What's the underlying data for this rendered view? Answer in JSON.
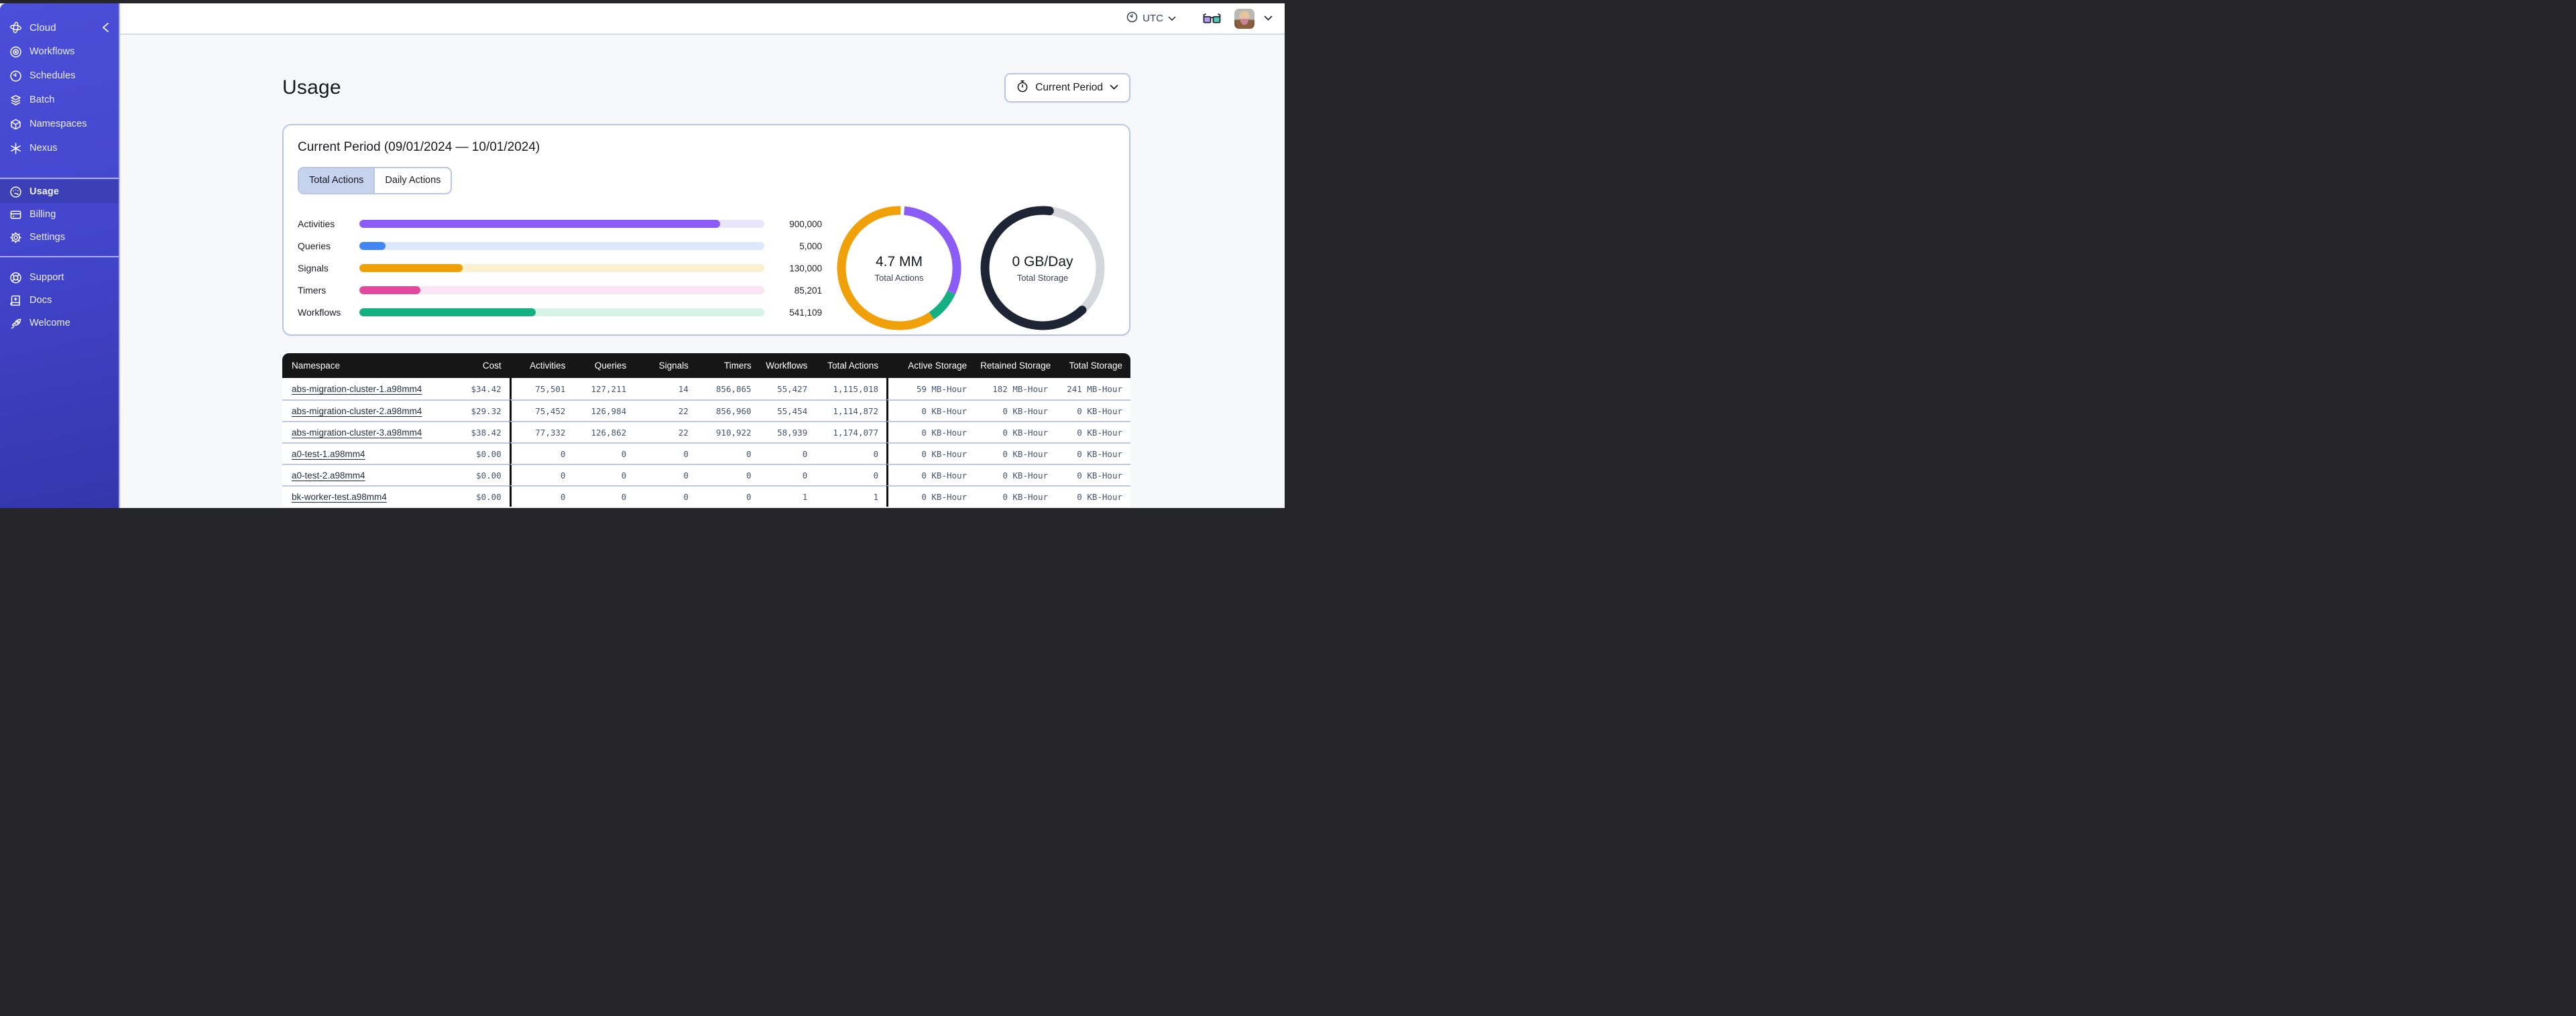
{
  "topbar": {
    "timezone": "UTC"
  },
  "sidebar": {
    "brand": "Cloud",
    "main_items": [
      {
        "label": "Workflows"
      },
      {
        "label": "Schedules"
      },
      {
        "label": "Batch"
      },
      {
        "label": "Namespaces"
      },
      {
        "label": "Nexus"
      }
    ],
    "account_items": [
      {
        "label": "Usage",
        "active": true
      },
      {
        "label": "Billing",
        "active": false
      },
      {
        "label": "Settings",
        "active": false
      }
    ],
    "footer_items": [
      {
        "label": "Support"
      },
      {
        "label": "Docs"
      },
      {
        "label": "Welcome"
      }
    ]
  },
  "page": {
    "title": "Usage",
    "period_button_label": "Current Period",
    "card_title": "Current Period (09/01/2024 — 10/01/2024)",
    "tabs": [
      {
        "label": "Total Actions",
        "active": true
      },
      {
        "label": "Daily Actions",
        "active": false
      }
    ]
  },
  "chart_data": [
    {
      "type": "bar",
      "title": "Current period action totals",
      "categories": [
        "Activities",
        "Queries",
        "Signals",
        "Timers",
        "Workflows"
      ],
      "values": [
        900000,
        5000,
        130000,
        85201,
        541109
      ],
      "items": [
        {
          "label": "Activities",
          "value": 900000,
          "display": "900,000",
          "pct_fill": 89,
          "color": "#8b5cf6",
          "track_color": "#eae6fa"
        },
        {
          "label": "Queries",
          "value": 5000,
          "display": "5,000",
          "pct_fill": 6.4,
          "color": "#4285f4",
          "track_color": "#dce8fb"
        },
        {
          "label": "Signals",
          "value": 130000,
          "display": "130,000",
          "pct_fill": 25.5,
          "color": "#f0a009",
          "track_color": "#fbf0cf"
        },
        {
          "label": "Timers",
          "value": 85201,
          "display": "85,201",
          "pct_fill": 15,
          "color": "#e2489d",
          "track_color": "#fbe4f3"
        },
        {
          "label": "Workflows",
          "value": 541109,
          "display": "541,109",
          "pct_fill": 43.6,
          "color": "#14b083",
          "track_color": "#d7f3e7"
        }
      ]
    },
    {
      "type": "donut",
      "center_value": "4.7 MM",
      "center_label": "Total Actions",
      "segments": [
        {
          "color": "#f0a009",
          "start": 40.5,
          "pct": 60
        },
        {
          "color": "#8b5cf6",
          "start": 1.5,
          "pct": 30.5
        },
        {
          "color": "#14b083",
          "start": 32,
          "pct": 8.5
        }
      ]
    },
    {
      "type": "donut",
      "center_value": "0 GB/Day",
      "center_label": "Total Storage",
      "segments": [
        {
          "color": "#d5d7dc",
          "start": 2,
          "pct": 36
        },
        {
          "color": "#1d2433",
          "start": 38,
          "pct": 64,
          "cap": "round"
        }
      ]
    }
  ],
  "table": {
    "columns": [
      {
        "label": "Namespace",
        "align": "left"
      },
      {
        "label": "Cost",
        "align": "right"
      },
      {
        "label": "Activities",
        "align": "right",
        "group_start": true
      },
      {
        "label": "Queries",
        "align": "right"
      },
      {
        "label": "Signals",
        "align": "right"
      },
      {
        "label": "Timers",
        "align": "right"
      },
      {
        "label": "Workflows",
        "align": "right"
      },
      {
        "label": "Total Actions",
        "align": "right"
      },
      {
        "label": "Active Storage",
        "align": "right",
        "group_start": true
      },
      {
        "label": "Retained Storage",
        "align": "right"
      },
      {
        "label": "Total Storage",
        "align": "right"
      }
    ],
    "rows": [
      {
        "namespace": "abs-migration-cluster-1.a98mm4",
        "cells": [
          "$34.42",
          "75,501",
          "127,211",
          "14",
          "856,865",
          "55,427",
          "1,115,018",
          "59 MB-Hour",
          "182 MB-Hour",
          "241 MB-Hour"
        ]
      },
      {
        "namespace": "abs-migration-cluster-2.a98mm4",
        "cells": [
          "$29.32",
          "75,452",
          "126,984",
          "22",
          "856,960",
          "55,454",
          "1,114,872",
          "0 KB-Hour",
          "0 KB-Hour",
          "0 KB-Hour"
        ]
      },
      {
        "namespace": "abs-migration-cluster-3.a98mm4",
        "cells": [
          "$38.42",
          "77,332",
          "126,862",
          "22",
          "910,922",
          "58,939",
          "1,174,077",
          "0 KB-Hour",
          "0 KB-Hour",
          "0 KB-Hour"
        ]
      },
      {
        "namespace": "a0-test-1.a98mm4",
        "cells": [
          "$0.00",
          "0",
          "0",
          "0",
          "0",
          "0",
          "0",
          "0 KB-Hour",
          "0 KB-Hour",
          "0 KB-Hour"
        ]
      },
      {
        "namespace": "a0-test-2.a98mm4",
        "cells": [
          "$0.00",
          "0",
          "0",
          "0",
          "0",
          "0",
          "0",
          "0 KB-Hour",
          "0 KB-Hour",
          "0 KB-Hour"
        ]
      },
      {
        "namespace": "bk-worker-test.a98mm4",
        "cells": [
          "$0.00",
          "0",
          "0",
          "0",
          "0",
          "1",
          "1",
          "0 KB-Hour",
          "0 KB-Hour",
          "0 KB-Hour"
        ]
      }
    ]
  }
}
